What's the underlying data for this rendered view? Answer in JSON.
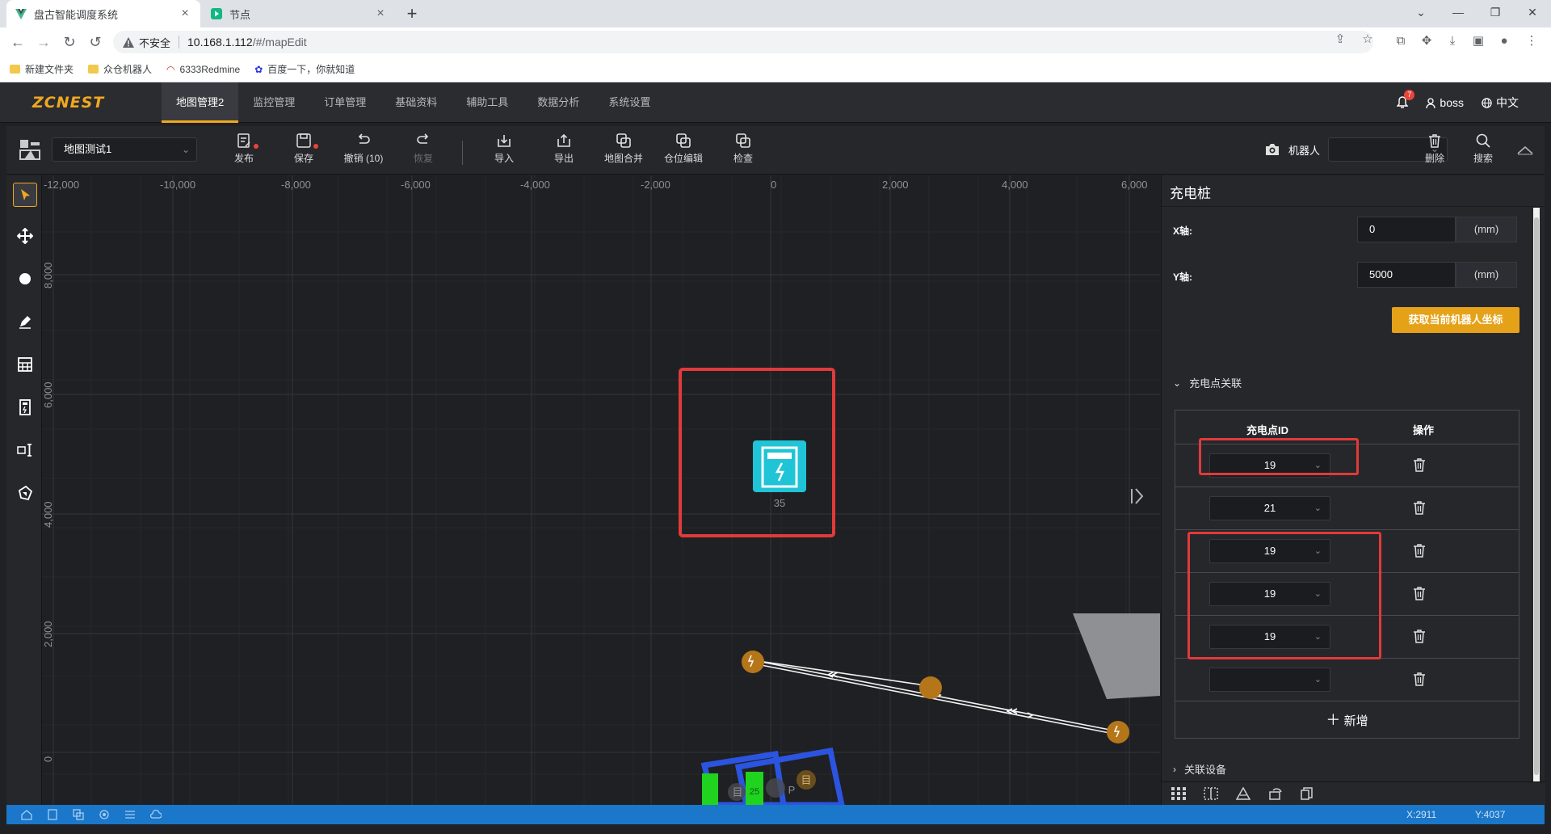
{
  "browser": {
    "tabs": [
      {
        "title": "盘古智能调度系统",
        "active": true
      },
      {
        "title": "节点",
        "active": false
      }
    ],
    "insecure_label": "不安全",
    "url_host": "10.168.1.112",
    "url_path": "/#/mapEdit",
    "bookmarks": [
      "新建文件夹",
      "众仓机器人",
      "6333Redmine",
      "百度一下，你就知道"
    ]
  },
  "app": {
    "logo": "ZCNEST",
    "menu": [
      "地图管理2",
      "监控管理",
      "订单管理",
      "基础资料",
      "辅助工具",
      "数据分析",
      "系统设置"
    ],
    "active_menu": "地图管理2",
    "notification_count": "7",
    "user": "boss",
    "language": "中文"
  },
  "toolbar": {
    "map_name": "地图测试1",
    "buttons": {
      "publish": "发布",
      "save": "保存",
      "undo": "撤销 (10)",
      "redo": "恢复",
      "import": "导入",
      "export": "导出",
      "merge": "地图合并",
      "bin_edit": "仓位编辑",
      "check": "检查"
    },
    "robot_label": "机器人",
    "robot_value": "",
    "delete": "删除",
    "search": "搜索"
  },
  "canvas": {
    "x_ticks": [
      "-12,000",
      "-10,000",
      "-8,000",
      "-6,000",
      "-4,000",
      "-2,000",
      "0",
      "2,000",
      "4,000",
      "6,000"
    ],
    "y_ticks": [
      "8,000",
      "6,000",
      "4,000",
      "2,000",
      "0"
    ],
    "charger_id": "35",
    "nodes_left": [
      "目",
      "25",
      "P",
      "目"
    ]
  },
  "panel": {
    "title": "充电桩",
    "x_label": "X轴:",
    "x_value": "0",
    "y_label": "Y轴:",
    "y_value": "5000",
    "unit": "(mm)",
    "get_coords_button": "获取当前机器人坐标",
    "charge_section": "充电点关联",
    "table_headers": {
      "id": "充电点ID",
      "op": "操作"
    },
    "rows": [
      "19",
      "21",
      "19",
      "19",
      "19",
      ""
    ],
    "add_label": "新增",
    "device_section": "关联设备"
  },
  "status": {
    "x": "X:2911",
    "y": "Y:4037"
  },
  "colors": {
    "accent": "#f0a820",
    "highlight_red": "#e13a3a",
    "charger_cyan": "#1fc4d6",
    "node_orange": "#b5761a",
    "status_blue": "#1b77c9"
  }
}
